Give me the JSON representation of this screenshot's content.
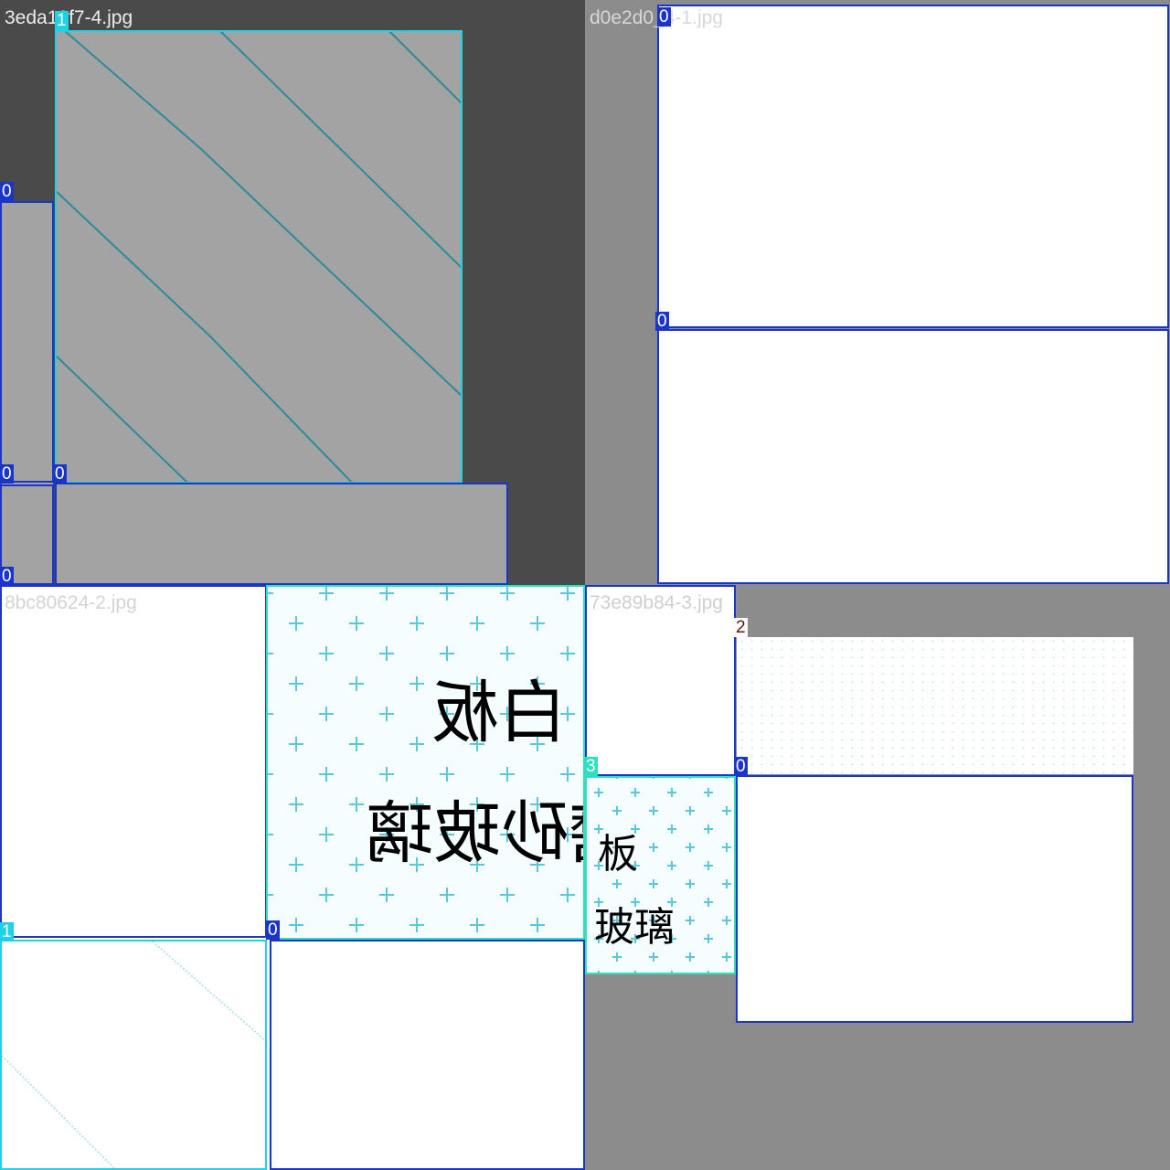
{
  "tiles": [
    {
      "filename": "3eda19f7-4.jpg",
      "background": "#4a4a4a"
    },
    {
      "filename": "d0e2d0_4-1.jpg",
      "background": "#8c8c8c"
    },
    {
      "filename": "8bc80624-2.jpg",
      "background": "#ffffff"
    },
    {
      "filename": "73e89b84-3.jpg",
      "background": "#8c8c8c"
    }
  ],
  "class_colors": {
    "0": "#1a35c8",
    "1": "#1ed2e6",
    "2": "#ffffff",
    "3": "#2ee0c0"
  },
  "labels": {
    "t1_big": "1",
    "t1_left": "0",
    "t1_leftbot": "0",
    "t1_mid": "0",
    "t1_bot": "0",
    "t2_top": "0",
    "t2_mid": "0",
    "t3_plus": "3",
    "t3_stripe": "1",
    "t3_bot": "0",
    "t4_speck": "2",
    "t4_plus": "3",
    "t4_white": "0",
    "t4_corner": "0"
  },
  "image_text": {
    "sign_line1": "白板",
    "sign_line2": "磨砂玻璃",
    "sign2_line1": "板",
    "sign2_line2": "玻璃"
  }
}
